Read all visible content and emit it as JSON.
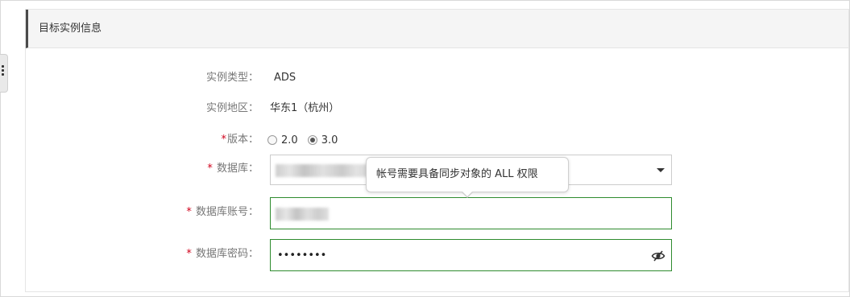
{
  "panel": {
    "title": "目标实例信息"
  },
  "form": {
    "instance_type": {
      "label": "实例类型：",
      "value": "ADS"
    },
    "instance_region": {
      "label": "实例地区：",
      "value": "华东1（杭州）"
    },
    "version": {
      "required_mark": "*",
      "label": "版本：",
      "options": [
        {
          "label": "2.0",
          "checked": false
        },
        {
          "label": "3.0",
          "checked": true
        }
      ]
    },
    "database": {
      "required_mark": "*",
      "label": "数据库：",
      "icon": "chevron-down-icon"
    },
    "account": {
      "required_mark": "*",
      "label": "数据库账号："
    },
    "password": {
      "required_mark": "*",
      "label": "数据库密码：",
      "masked_value": "••••••••",
      "icon": "eye-hidden-icon"
    }
  },
  "tooltip": {
    "text": "帐号需要具备同步对象的 ALL 权限"
  },
  "colors": {
    "required": "#d0021b",
    "focus_border": "#2e8b2e",
    "header_bg": "#f5f5f5"
  }
}
